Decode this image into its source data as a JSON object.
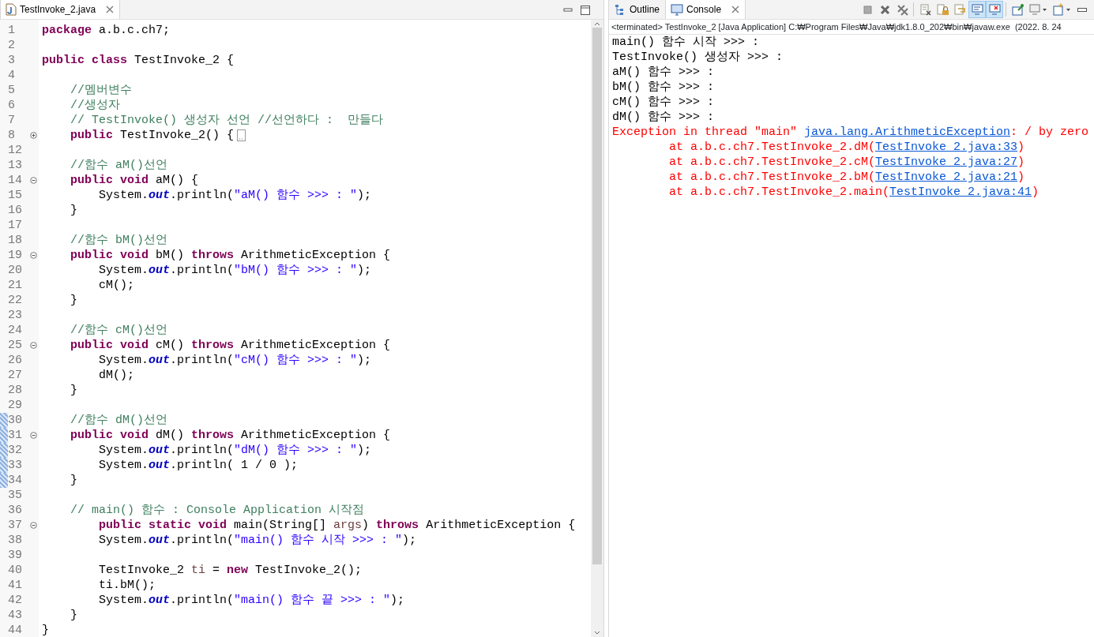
{
  "editor": {
    "tabs": [
      {
        "title": "TestInvoke_2.java",
        "selected": true
      }
    ],
    "lines": [
      {
        "number": "1",
        "changed": false,
        "segments": [
          {
            "kind": "keyword",
            "text": "package"
          },
          {
            "kind": "plain",
            "text": " a.b.c.ch7;"
          }
        ]
      },
      {
        "number": "2",
        "changed": false
      },
      {
        "number": "3",
        "changed": false,
        "segments": [
          {
            "kind": "keyword",
            "text": "public class"
          },
          {
            "kind": "plain",
            "text": " TestInvoke_2 {"
          }
        ]
      },
      {
        "number": "4",
        "changed": false
      },
      {
        "number": "5",
        "changed": false,
        "segments": [
          {
            "kind": "comment",
            "text": "    //멤버변수"
          }
        ]
      },
      {
        "number": "6",
        "changed": false,
        "segments": [
          {
            "kind": "comment",
            "text": "    //생성자"
          }
        ]
      },
      {
        "number": "7",
        "changed": false,
        "segments": [
          {
            "kind": "comment",
            "text": "    // TestInvoke() 생성자 선언 //선언하다 :  만들다"
          }
        ]
      },
      {
        "number": "8",
        "changed": false,
        "collapsed": true,
        "segments": [
          {
            "kind": "keyword",
            "text": "    public"
          },
          {
            "kind": "plain",
            "text": " TestInvoke_2() {"
          }
        ]
      },
      {
        "number": "12",
        "changed": false
      },
      {
        "number": "13",
        "changed": false,
        "segments": [
          {
            "kind": "comment",
            "text": "    //함수 aM()선언"
          }
        ]
      },
      {
        "number": "14",
        "changed": false,
        "collapsed": false,
        "segments": [
          {
            "kind": "keyword",
            "text": "    public void"
          },
          {
            "kind": "plain",
            "text": " aM() {"
          }
        ]
      },
      {
        "number": "15",
        "changed": false,
        "segments": [
          {
            "kind": "plain",
            "text": "        System."
          },
          {
            "kind": "field",
            "text": "out"
          },
          {
            "kind": "plain",
            "text": ".println("
          },
          {
            "kind": "string",
            "text": "\"aM() 함수 >>> : \""
          },
          {
            "kind": "plain",
            "text": ");"
          }
        ]
      },
      {
        "number": "16",
        "changed": false,
        "segments": [
          {
            "kind": "plain",
            "text": "    }"
          }
        ]
      },
      {
        "number": "17",
        "changed": false
      },
      {
        "number": "18",
        "changed": false,
        "segments": [
          {
            "kind": "comment",
            "text": "    //함수 bM()선언"
          }
        ]
      },
      {
        "number": "19",
        "changed": false,
        "collapsed": false,
        "segments": [
          {
            "kind": "keyword",
            "text": "    public void"
          },
          {
            "kind": "plain",
            "text": " bM() "
          },
          {
            "kind": "keyword",
            "text": "throws"
          },
          {
            "kind": "plain",
            "text": " ArithmeticException {"
          }
        ]
      },
      {
        "number": "20",
        "changed": false,
        "segments": [
          {
            "kind": "plain",
            "text": "        System."
          },
          {
            "kind": "field",
            "text": "out"
          },
          {
            "kind": "plain",
            "text": ".println("
          },
          {
            "kind": "string",
            "text": "\"bM() 함수 >>> : \""
          },
          {
            "kind": "plain",
            "text": ");"
          }
        ]
      },
      {
        "number": "21",
        "changed": false,
        "segments": [
          {
            "kind": "plain",
            "text": "        cM();"
          }
        ]
      },
      {
        "number": "22",
        "changed": false,
        "segments": [
          {
            "kind": "plain",
            "text": "    }"
          }
        ]
      },
      {
        "number": "23",
        "changed": false
      },
      {
        "number": "24",
        "changed": false,
        "segments": [
          {
            "kind": "comment",
            "text": "    //함수 cM()선언"
          }
        ]
      },
      {
        "number": "25",
        "changed": false,
        "collapsed": false,
        "segments": [
          {
            "kind": "keyword",
            "text": "    public void"
          },
          {
            "kind": "plain",
            "text": " cM() "
          },
          {
            "kind": "keyword",
            "text": "throws"
          },
          {
            "kind": "plain",
            "text": " ArithmeticException {"
          }
        ]
      },
      {
        "number": "26",
        "changed": false,
        "segments": [
          {
            "kind": "plain",
            "text": "        System."
          },
          {
            "kind": "field",
            "text": "out"
          },
          {
            "kind": "plain",
            "text": ".println("
          },
          {
            "kind": "string",
            "text": "\"cM() 함수 >>> : \""
          },
          {
            "kind": "plain",
            "text": ");"
          }
        ]
      },
      {
        "number": "27",
        "changed": false,
        "segments": [
          {
            "kind": "plain",
            "text": "        dM();"
          }
        ]
      },
      {
        "number": "28",
        "changed": false,
        "segments": [
          {
            "kind": "plain",
            "text": "    }"
          }
        ]
      },
      {
        "number": "29",
        "changed": false
      },
      {
        "number": "30",
        "changed": true,
        "segments": [
          {
            "kind": "comment",
            "text": "    //함수 dM()선언"
          }
        ]
      },
      {
        "number": "31",
        "changed": true,
        "collapsed": false,
        "segments": [
          {
            "kind": "keyword",
            "text": "    public void"
          },
          {
            "kind": "plain",
            "text": " dM() "
          },
          {
            "kind": "keyword",
            "text": "throws"
          },
          {
            "kind": "plain",
            "text": " ArithmeticException {"
          }
        ]
      },
      {
        "number": "32",
        "changed": true,
        "segments": [
          {
            "kind": "plain",
            "text": "        System."
          },
          {
            "kind": "field",
            "text": "out"
          },
          {
            "kind": "plain",
            "text": ".println("
          },
          {
            "kind": "string",
            "text": "\"dM() 함수 >>> : \""
          },
          {
            "kind": "plain",
            "text": ");"
          }
        ]
      },
      {
        "number": "33",
        "changed": true,
        "segments": [
          {
            "kind": "plain",
            "text": "        System."
          },
          {
            "kind": "field",
            "text": "out"
          },
          {
            "kind": "plain",
            "text": ".println( 1 / 0 );"
          }
        ]
      },
      {
        "number": "34",
        "changed": true,
        "segments": [
          {
            "kind": "plain",
            "text": "    }"
          }
        ]
      },
      {
        "number": "35",
        "changed": false
      },
      {
        "number": "36",
        "changed": false,
        "segments": [
          {
            "kind": "comment",
            "text": "    // main() 함수 : Console Application 시작점"
          }
        ]
      },
      {
        "number": "37",
        "changed": false,
        "collapsed": false,
        "segments": [
          {
            "kind": "keyword",
            "text": "        public static void"
          },
          {
            "kind": "plain",
            "text": " main(String[] "
          },
          {
            "kind": "param",
            "text": "args"
          },
          {
            "kind": "plain",
            "text": ") "
          },
          {
            "kind": "keyword",
            "text": "throws"
          },
          {
            "kind": "plain",
            "text": " ArithmeticException {"
          }
        ]
      },
      {
        "number": "38",
        "changed": false,
        "segments": [
          {
            "kind": "plain",
            "text": "        System."
          },
          {
            "kind": "field",
            "text": "out"
          },
          {
            "kind": "plain",
            "text": ".println("
          },
          {
            "kind": "string",
            "text": "\"main() 함수 시작 >>> : \""
          },
          {
            "kind": "plain",
            "text": ");"
          }
        ]
      },
      {
        "number": "39",
        "changed": false
      },
      {
        "number": "40",
        "changed": false,
        "segments": [
          {
            "kind": "plain",
            "text": "        TestInvoke_2 "
          },
          {
            "kind": "param",
            "text": "ti"
          },
          {
            "kind": "plain",
            "text": " = "
          },
          {
            "kind": "keyword",
            "text": "new"
          },
          {
            "kind": "plain",
            "text": " TestInvoke_2();"
          }
        ]
      },
      {
        "number": "41",
        "changed": false,
        "segments": [
          {
            "kind": "plain",
            "text": "        ti.bM();"
          }
        ]
      },
      {
        "number": "42",
        "changed": false,
        "segments": [
          {
            "kind": "plain",
            "text": "        System."
          },
          {
            "kind": "field",
            "text": "out"
          },
          {
            "kind": "plain",
            "text": ".println("
          },
          {
            "kind": "string",
            "text": "\"main() 함수 끝 >>> : \""
          },
          {
            "kind": "plain",
            "text": ");"
          }
        ]
      },
      {
        "number": "43",
        "changed": false,
        "segments": [
          {
            "kind": "plain",
            "text": "    }"
          }
        ]
      },
      {
        "number": "44",
        "changed": false,
        "segments": [
          {
            "kind": "plain",
            "text": "}"
          }
        ]
      }
    ]
  },
  "console": {
    "tabs": [
      {
        "title": "Outline",
        "kind": "outline",
        "selected": false
      },
      {
        "title": "Console",
        "kind": "console",
        "selected": true
      }
    ],
    "toolbar": [
      {
        "kind": "stop",
        "selected": false
      },
      {
        "kind": "remove",
        "selected": false
      },
      {
        "kind": "remove-all",
        "selected": false
      },
      {
        "kind": "separator"
      },
      {
        "kind": "clear",
        "selected": false
      },
      {
        "kind": "scroll-lock",
        "selected": false
      },
      {
        "kind": "word-wrap",
        "selected": false
      },
      {
        "kind": "stdout",
        "selected": true
      },
      {
        "kind": "stderr",
        "selected": true
      },
      {
        "kind": "separator"
      },
      {
        "kind": "pin",
        "selected": false
      },
      {
        "kind": "display",
        "selected": false
      },
      {
        "kind": "new-console",
        "selected": false
      },
      {
        "kind": "minimize",
        "selected": false
      }
    ],
    "status": "<terminated> TestInvoke_2 [Java Application] C:₩Program Files₩Java₩jdk1.8.0_202₩bin₩javaw.exe  (2022. 8. 24",
    "lines": [
      {
        "segments": [
          {
            "kind": "output",
            "text": "main() 함수 시작 >>> :"
          }
        ]
      },
      {
        "segments": [
          {
            "kind": "output",
            "text": "TestInvoke() 생성자 >>> :"
          }
        ]
      },
      {
        "segments": [
          {
            "kind": "output",
            "text": "aM() 함수 >>> :"
          }
        ]
      },
      {
        "segments": [
          {
            "kind": "output",
            "text": "bM() 함수 >>> :"
          }
        ]
      },
      {
        "segments": [
          {
            "kind": "output",
            "text": "cM() 함수 >>> :"
          }
        ]
      },
      {
        "segments": [
          {
            "kind": "output",
            "text": "dM() 함수 >>> :"
          }
        ]
      },
      {
        "segments": [
          {
            "kind": "error",
            "text": "Exception in thread \"main\" "
          },
          {
            "kind": "link",
            "text": "java.lang.ArithmeticException"
          },
          {
            "kind": "error",
            "text": ": / by zero"
          }
        ]
      },
      {
        "segments": [
          {
            "kind": "error",
            "text": "\tat a.b.c.ch7.TestInvoke_2.dM("
          },
          {
            "kind": "link",
            "text": "TestInvoke_2.java:33"
          },
          {
            "kind": "error",
            "text": ")"
          }
        ]
      },
      {
        "segments": [
          {
            "kind": "error",
            "text": "\tat a.b.c.ch7.TestInvoke_2.cM("
          },
          {
            "kind": "link",
            "text": "TestInvoke_2.java:27"
          },
          {
            "kind": "error",
            "text": ")"
          }
        ]
      },
      {
        "segments": [
          {
            "kind": "error",
            "text": "\tat a.b.c.ch7.TestInvoke_2.bM("
          },
          {
            "kind": "link",
            "text": "TestInvoke_2.java:21"
          },
          {
            "kind": "error",
            "text": ")"
          }
        ]
      },
      {
        "segments": [
          {
            "kind": "error",
            "text": "\tat a.b.c.ch7.TestInvoke_2.main("
          },
          {
            "kind": "link",
            "text": "TestInvoke_2.java:41"
          },
          {
            "kind": "error",
            "text": ")"
          }
        ]
      }
    ]
  }
}
